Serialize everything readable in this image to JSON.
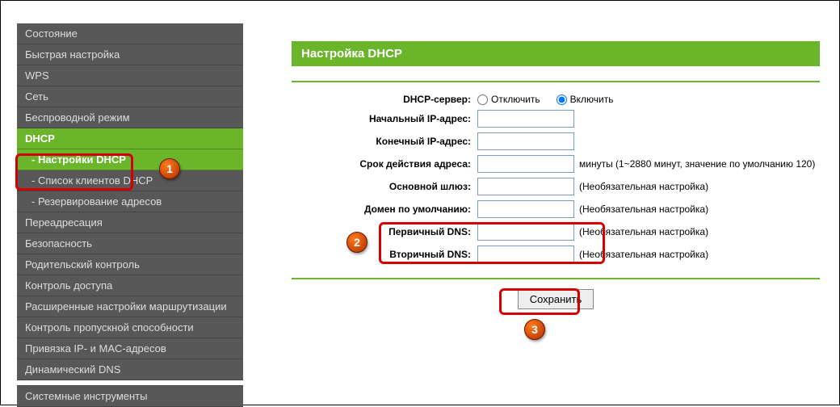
{
  "sidebar": {
    "items": [
      {
        "label": "Состояние"
      },
      {
        "label": "Быстрая настройка"
      },
      {
        "label": "WPS"
      },
      {
        "label": "Сеть"
      },
      {
        "label": "Беспроводной режим"
      },
      {
        "label": "DHCP"
      },
      {
        "label": "- Настройки DHCP"
      },
      {
        "label": "- Список клиентов DHCP"
      },
      {
        "label": "- Резервирование адресов"
      },
      {
        "label": "Переадресация"
      },
      {
        "label": "Безопасность"
      },
      {
        "label": "Родительский контроль"
      },
      {
        "label": "Контроль доступа"
      },
      {
        "label": "Расширенные настройки маршрутизации"
      },
      {
        "label": "Контроль пропускной способности"
      },
      {
        "label": "Привязка IP- и MAC-адресов"
      },
      {
        "label": "Динамический DNS"
      },
      {
        "label": "Системные инструменты"
      }
    ]
  },
  "page": {
    "title": "Настройка DHCP"
  },
  "form": {
    "dhcp_server_label": "DHCP-сервер:",
    "radio_disable": "Отключить",
    "radio_enable": "Включить",
    "start_ip_label": "Начальный IP-адрес:",
    "start_ip_value": "",
    "end_ip_label": "Конечный IP-адрес:",
    "end_ip_value": "",
    "lease_label": "Срок действия адреса:",
    "lease_value": "",
    "lease_hint": "минуты (1~2880 минут, значение по умолчанию 120)",
    "gateway_label": "Основной шлюз:",
    "gateway_value": "",
    "gateway_hint": "(Необязательная настройка)",
    "domain_label": "Домен по умолчанию:",
    "domain_value": "",
    "domain_hint": "(Необязательная настройка)",
    "dns1_label": "Первичный DNS:",
    "dns1_value": "",
    "dns1_hint": "(Необязательная настройка)",
    "dns2_label": "Вторичный DNS:",
    "dns2_value": "",
    "dns2_hint": "(Необязательная настройка)",
    "save_label": "Сохранить"
  },
  "markers": {
    "one": "1",
    "two": "2",
    "three": "3"
  }
}
